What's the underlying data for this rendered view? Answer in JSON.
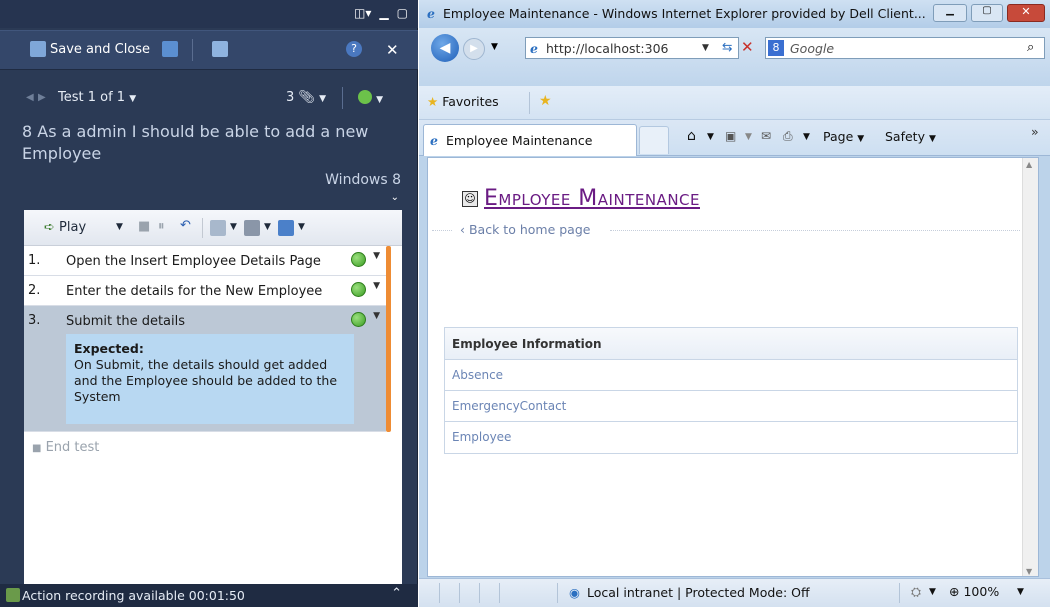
{
  "runner": {
    "toolbar": {
      "save_close_label": "Save and Close"
    },
    "nav": {
      "test_label": "Test 1 of 1",
      "attachments_count": "3"
    },
    "test_title": "8 As a admin I should be able to add a new Employee",
    "environment": "Windows 8",
    "steps_toolbar": {
      "play_label": "Play"
    },
    "steps": [
      {
        "num": "1.",
        "text": "Open the Insert Employee Details Page"
      },
      {
        "num": "2.",
        "text": "Enter the details for the New Employee"
      },
      {
        "num": "3.",
        "text": "Submit the details"
      }
    ],
    "expected": {
      "heading": "Expected:",
      "text": "On Submit, the details should get added and the Employee should be added to the System"
    },
    "end_test_label": "End test",
    "status": {
      "text": "Action recording available 00:01:50"
    }
  },
  "ie": {
    "window_title": "Employee Maintenance - Windows Internet Explorer provided by Dell Client...",
    "address": "http://localhost:306",
    "search_placeholder": "Google",
    "favorites_label": "Favorites",
    "tab_title": "Employee Maintenance",
    "toolbar": {
      "page_label": "Page",
      "safety_label": "Safety",
      "more_label": "»"
    },
    "status": {
      "zone": "Local intranet | Protected Mode: Off",
      "zoom": "100%"
    }
  },
  "page": {
    "title": "Employee Maintenance",
    "back_link": "Back to home page",
    "table_header": "Employee Information",
    "rows": [
      "Absence",
      "EmergencyContact",
      "Employee"
    ]
  }
}
